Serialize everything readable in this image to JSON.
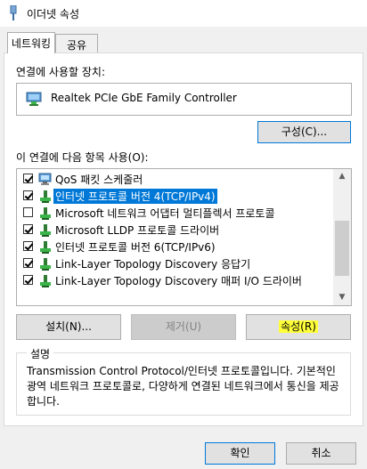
{
  "window": {
    "title": "이더넷 속성"
  },
  "tabs": [
    {
      "label": "네트워킹",
      "active": true
    },
    {
      "label": "공유",
      "active": false
    }
  ],
  "device": {
    "label": "연결에 사용할 장치:",
    "name": "Realtek PCIe GbE Family Controller",
    "configure_button": "구성(C)..."
  },
  "items": {
    "label": "이 연결에 다음 항목 사용(O):",
    "list": [
      {
        "text": "QoS 패킷 스케줄러",
        "checked": true,
        "selected": false,
        "icon": "network-service-icon"
      },
      {
        "text": "인터넷 프로토콜 버전 4(TCP/IPv4)",
        "checked": true,
        "selected": true,
        "icon": "protocol-icon"
      },
      {
        "text": "Microsoft 네트워크 어댑터 멀티플렉서 프로토콜",
        "checked": false,
        "selected": false,
        "icon": "protocol-icon"
      },
      {
        "text": "Microsoft LLDP 프로토콜 드라이버",
        "checked": true,
        "selected": false,
        "icon": "protocol-icon"
      },
      {
        "text": "인터넷 프로토콜 버전 6(TCP/IPv6)",
        "checked": true,
        "selected": false,
        "icon": "protocol-icon"
      },
      {
        "text": "Link-Layer Topology Discovery 응답기",
        "checked": true,
        "selected": false,
        "icon": "protocol-icon"
      },
      {
        "text": "Link-Layer Topology Discovery 매퍼 I/O 드라이버",
        "checked": true,
        "selected": false,
        "icon": "protocol-icon"
      }
    ]
  },
  "buttons": {
    "install": "설치(N)...",
    "uninstall": "제거(U)",
    "properties": "속성(R)",
    "ok": "확인",
    "cancel": "취소"
  },
  "description": {
    "title": "설명",
    "text": "Transmission Control Protocol/인터넷 프로토콜입니다. 기본적인 광역 네트워크 프로토콜로, 다양하게 연결된 네트워크에서 통신을 제공합니다."
  },
  "colors": {
    "selection": "#0078d7",
    "highlight": "#ffff3a",
    "focus_border": "#0078d7"
  }
}
